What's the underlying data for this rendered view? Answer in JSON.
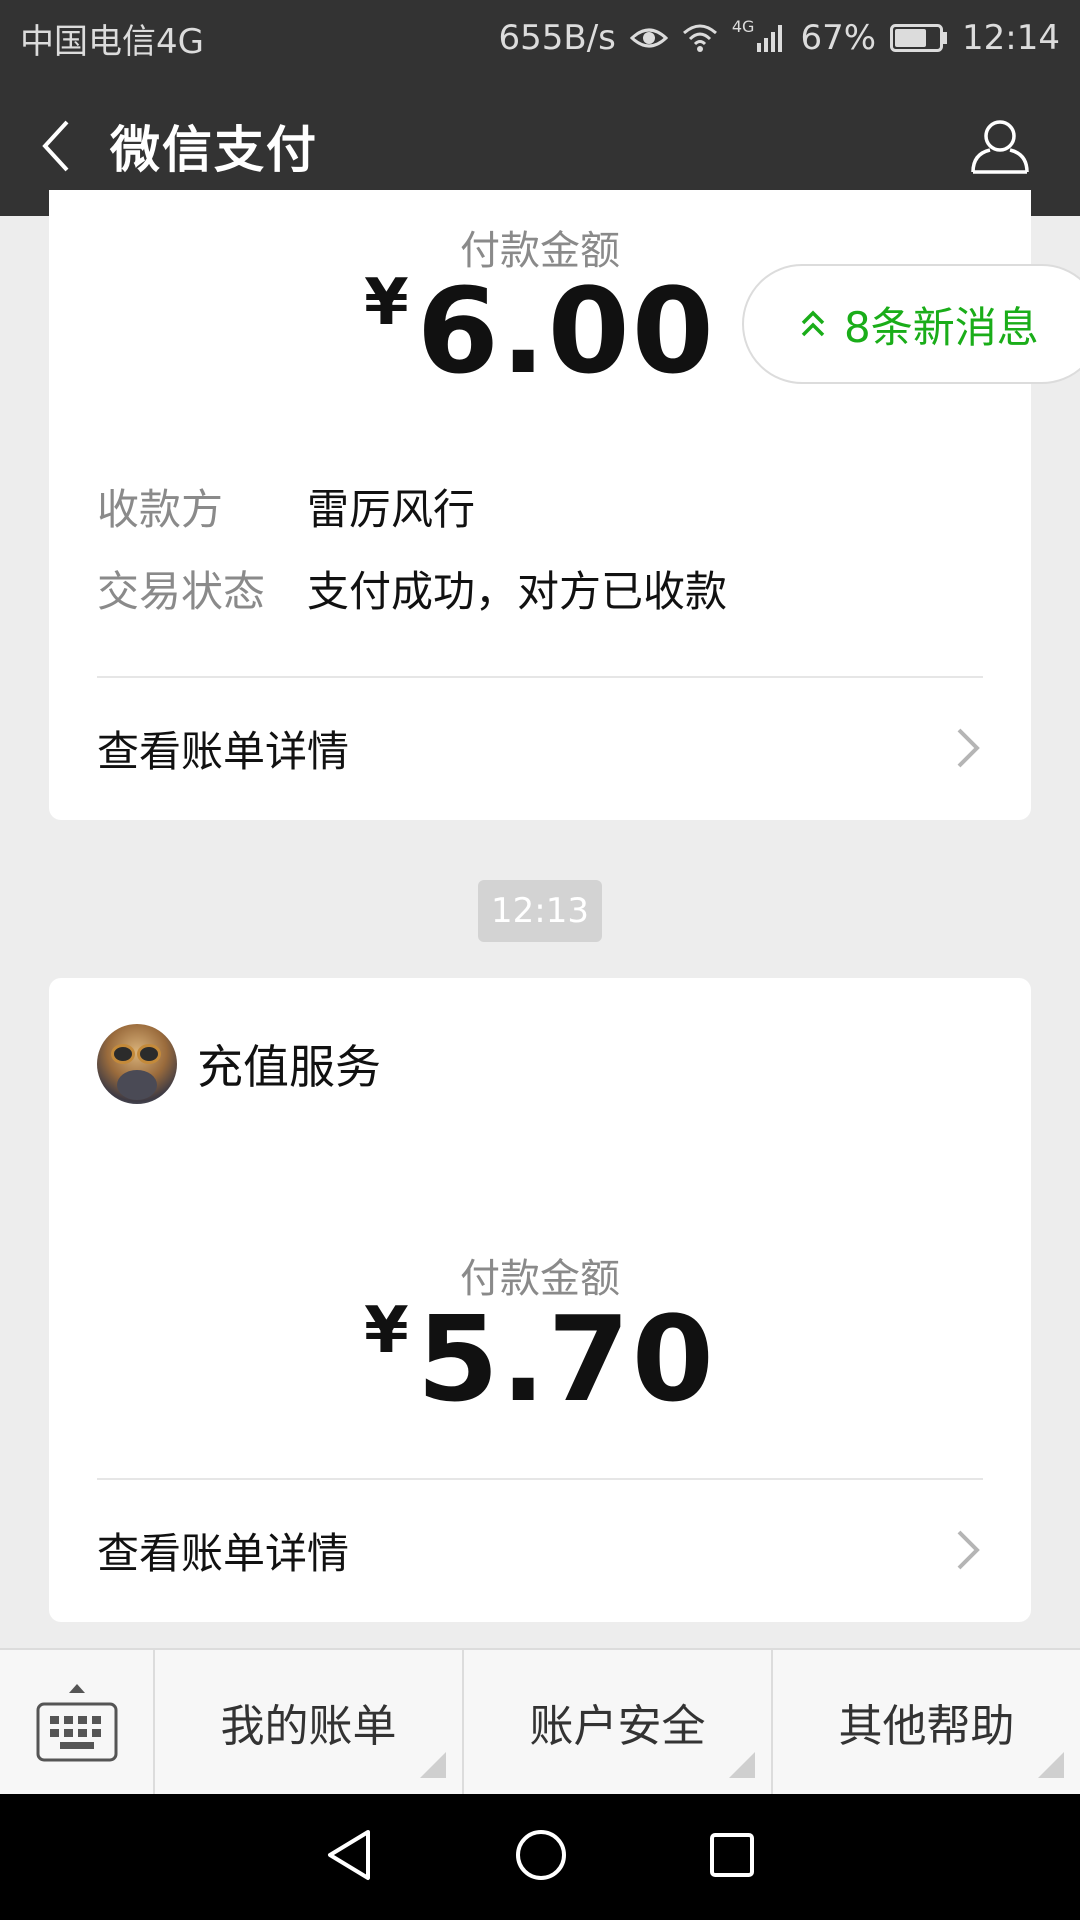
{
  "status_bar": {
    "carrier": "中国电信4G",
    "speed": "655B/s",
    "network": "4G",
    "battery": "67%",
    "time": "12:14"
  },
  "title_bar": {
    "title": "微信支付"
  },
  "new_messages": {
    "label": "8条新消息"
  },
  "card1": {
    "amount_label": "付款金额",
    "currency": "¥",
    "amount": "6.00",
    "payee_key": "收款方",
    "payee_value": "雷厉风行",
    "status_key": "交易状态",
    "status_value": "支付成功，对方已收款",
    "detail_link": "查看账单详情"
  },
  "timestamp": "12:13",
  "card2": {
    "service_name": "充值服务",
    "amount_label": "付款金额",
    "currency": "¥",
    "amount": "5.70",
    "detail_link": "查看账单详情"
  },
  "bottom_menu": {
    "items": [
      "我的账单",
      "账户安全",
      "其他帮助"
    ]
  },
  "colors": {
    "bar_bg": "#333333",
    "accent_green": "#1aad19",
    "page_bg": "#ededed"
  }
}
